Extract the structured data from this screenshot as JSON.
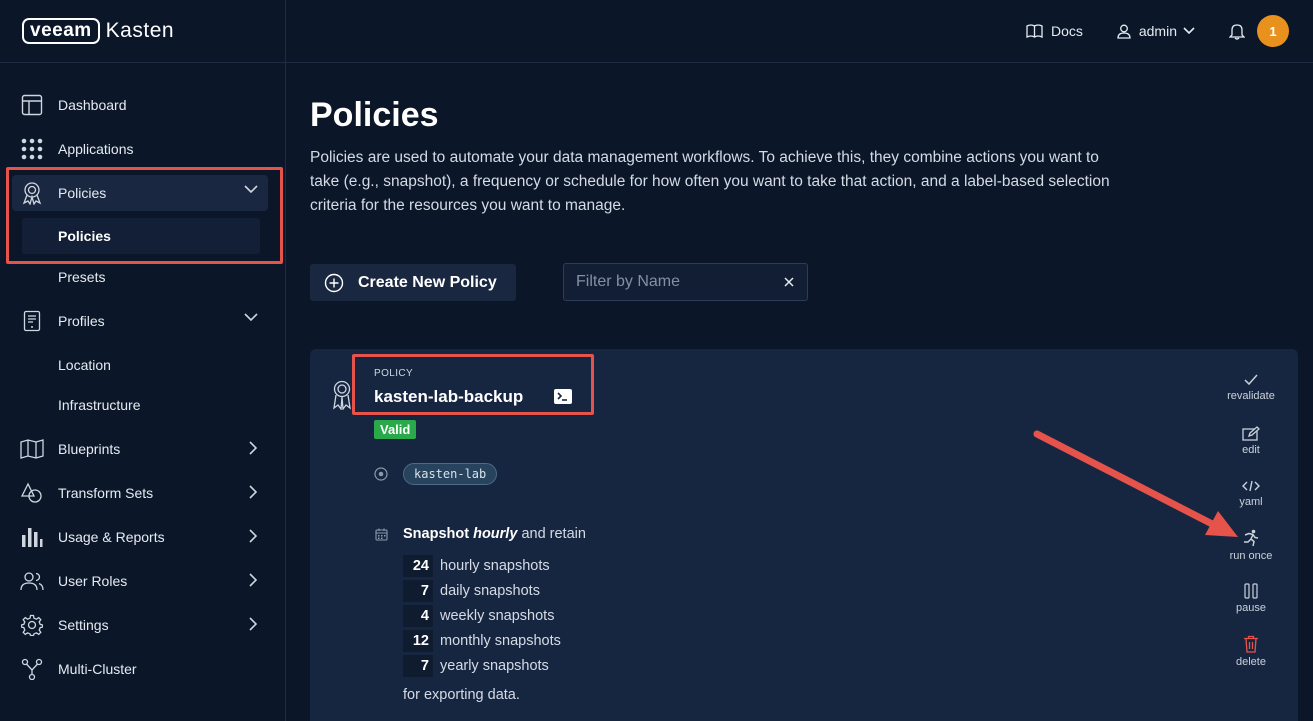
{
  "brand": {
    "logo_box": "veeam",
    "logo_text": "Kasten"
  },
  "topbar": {
    "docs": "Docs",
    "user": "admin",
    "notifications": "1"
  },
  "sidebar": {
    "items": [
      {
        "label": "Dashboard",
        "icon": "dashboard-icon"
      },
      {
        "label": "Applications",
        "icon": "applications-icon"
      },
      {
        "label": "Policies",
        "icon": "policies-icon",
        "expanded": true
      },
      {
        "label": "Profiles",
        "icon": "profiles-icon",
        "expanded": true
      },
      {
        "label": "Blueprints",
        "icon": "blueprints-icon"
      },
      {
        "label": "Transform Sets",
        "icon": "transform-sets-icon"
      },
      {
        "label": "Usage & Reports",
        "icon": "usage-reports-icon"
      },
      {
        "label": "User Roles",
        "icon": "user-roles-icon"
      },
      {
        "label": "Settings",
        "icon": "settings-icon"
      },
      {
        "label": "Multi-Cluster",
        "icon": "multi-cluster-icon"
      }
    ],
    "policies_sub": [
      "Policies",
      "Presets"
    ],
    "profiles_sub": [
      "Location",
      "Infrastructure"
    ]
  },
  "main": {
    "title": "Policies",
    "description": "Policies are used to automate your data management workflows. To achieve this, they combine actions you want to take (e.g., snapshot), a frequency or schedule for how often you want to take that action, and a label-based selection criteria for the resources you want to manage.",
    "create_button": "Create New Policy",
    "filter_placeholder": "Filter by Name"
  },
  "policy": {
    "label": "POLICY",
    "name": "kasten-lab-backup",
    "status": "Valid",
    "namespace": "kasten-lab",
    "snapshot_prefix": "Snapshot",
    "frequency": "hourly",
    "snapshot_suffix": "and retain",
    "retention": [
      {
        "count": "24",
        "label": "hourly snapshots"
      },
      {
        "count": "7",
        "label": "daily snapshots"
      },
      {
        "count": "4",
        "label": "weekly snapshots"
      },
      {
        "count": "12",
        "label": "monthly snapshots"
      },
      {
        "count": "7",
        "label": "yearly snapshots"
      }
    ],
    "export_note": "for exporting data.",
    "actions": [
      "revalidate",
      "edit",
      "yaml",
      "run once",
      "pause",
      "delete"
    ]
  },
  "colors": {
    "accent_highlight": "#e5534b",
    "valid": "#2aa94b",
    "notification": "#e8911c",
    "delete": "#e5534b"
  }
}
